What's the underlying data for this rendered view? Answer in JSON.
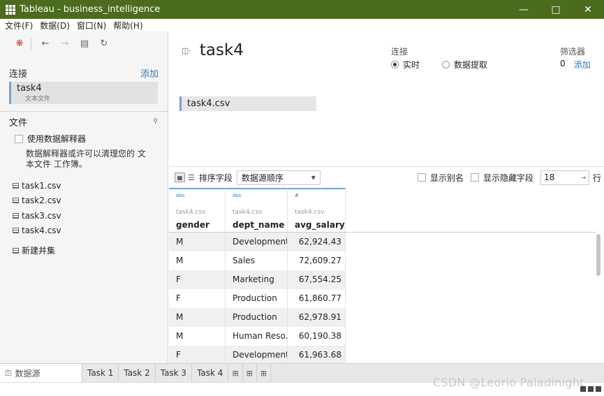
{
  "window": {
    "title": "Tableau - business_intelligence"
  },
  "menu": [
    "文件(F)",
    "数据(D)",
    "窗口(N)",
    "帮助(H)"
  ],
  "connections": {
    "heading": "连接",
    "add_label": "添加",
    "item_name": "task4",
    "item_type": "文本文件"
  },
  "files": {
    "heading": "文件",
    "interpreter_label": "使用数据解释器",
    "interpreter_desc": "数据解释器或许可以清理您的 文本文件 工作簿。",
    "items": [
      "task1.csv",
      "task2.csv",
      "task3.csv",
      "task4.csv"
    ],
    "new_union": "新建并集"
  },
  "datasource": {
    "title": "task4",
    "connection_label": "连接",
    "live_label": "实时",
    "extract_label": "数据提取",
    "filters_label": "筛选器",
    "filters_count": "0",
    "filters_add": "添加",
    "table_name": "task4.csv"
  },
  "grid_toolbar": {
    "sort_label": "排序字段",
    "sort_value": "数据源顺序",
    "show_alias": "显示别名",
    "show_hidden": "显示隐藏字段",
    "rows_value": "18",
    "rows_unit": "行"
  },
  "grid": {
    "columns": [
      {
        "type": "Abc",
        "source": "task4.csv",
        "name": "gender"
      },
      {
        "type": "Abc",
        "source": "task4.csv",
        "name": "dept_name"
      },
      {
        "type": "#",
        "source": "task4.csv",
        "name": "avg_salary"
      }
    ],
    "rows": [
      [
        "M",
        "Development",
        "62,924.43"
      ],
      [
        "M",
        "Sales",
        "72,609.27"
      ],
      [
        "F",
        "Marketing",
        "67,554.25"
      ],
      [
        "F",
        "Production",
        "61,860.77"
      ],
      [
        "M",
        "Production",
        "62,978.91"
      ],
      [
        "M",
        "Human Reso...",
        "60,190.38"
      ],
      [
        "F",
        "Development",
        "61,963.68"
      ]
    ]
  },
  "tabs": {
    "datasource": "数据源",
    "sheets": [
      "Task 1",
      "Task 2",
      "Task 3",
      "Task 4"
    ]
  },
  "watermark": "CSDN @Leorio Paladinight",
  "colors": {
    "titlebar": "#4b6b1f",
    "accent": "#2a7bbf",
    "selection": "#7aa1c8"
  }
}
